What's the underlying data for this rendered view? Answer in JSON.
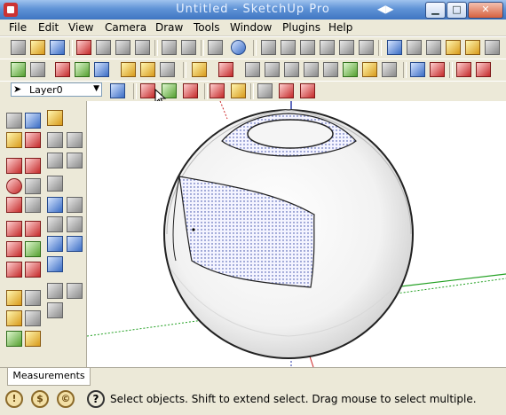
{
  "window": {
    "title": "Untitled - SketchUp Pro"
  },
  "menu": [
    "File",
    "Edit",
    "View",
    "Camera",
    "Draw",
    "Tools",
    "Window",
    "Plugins",
    "Help"
  ],
  "layer": {
    "value": "Layer0"
  },
  "measurements": {
    "tab_label": "Measurements"
  },
  "status": {
    "message": "Select objects. Shift to extend select. Drag mouse to select multiple."
  },
  "icons": {
    "colors": [
      "a",
      "b",
      "c",
      "d",
      "e"
    ]
  },
  "colors": {
    "titlebar": "#3f75c2",
    "axis_red": "#cc2222",
    "axis_green": "#22a022",
    "axis_blue": "#2a3aa8"
  }
}
